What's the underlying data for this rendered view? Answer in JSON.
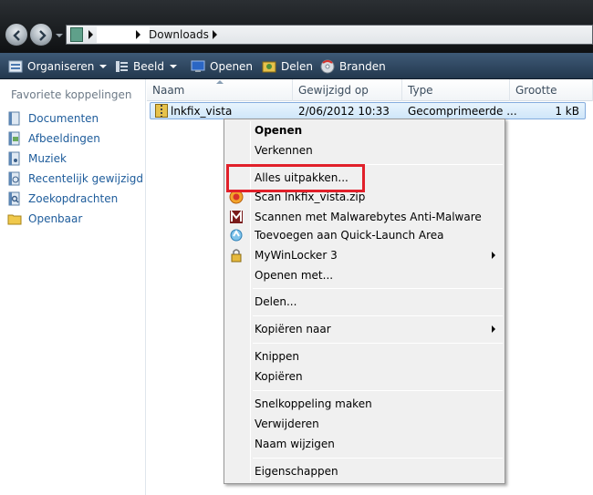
{
  "address": {
    "crumb": "Downloads"
  },
  "toolbar": {
    "organise": "Organiseren",
    "view": "Beeld",
    "open": "Openen",
    "share": "Delen",
    "burn": "Branden"
  },
  "nav": {
    "header": "Favoriete koppelingen",
    "items": [
      {
        "label": "Documenten",
        "icon": "documents-icon"
      },
      {
        "label": "Afbeeldingen",
        "icon": "pictures-icon"
      },
      {
        "label": "Muziek",
        "icon": "music-icon"
      },
      {
        "label": "Recentelijk gewijzigd",
        "icon": "recent-icon"
      },
      {
        "label": "Zoekopdrachten",
        "icon": "search-icon"
      },
      {
        "label": "Openbaar",
        "icon": "public-folder-icon"
      }
    ]
  },
  "columns": {
    "name": "Naam",
    "modified": "Gewijzigd op",
    "type": "Type",
    "size": "Grootte"
  },
  "file": {
    "name": "lnkfix_vista",
    "modified": "2/06/2012 10:33",
    "type": "Gecomprimeerde ...",
    "size": "1 kB"
  },
  "menu": {
    "open": "Openen",
    "explore": "Verkennen",
    "extract_all": "Alles uitpakken...",
    "scan": "Scan lnkfix_vista.zip",
    "malwarebytes": "Scannen met Malwarebytes Anti-Malware",
    "quicklaunch": "Toevoegen aan Quick-Launch Area",
    "mywinlocker": "MyWinLocker 3",
    "open_with": "Openen met...",
    "share": "Delen...",
    "copy_to": "Kopiëren naar",
    "cut": "Knippen",
    "copy": "Kopiëren",
    "shortcut": "Snelkoppeling maken",
    "delete": "Verwijderen",
    "rename": "Naam wijzigen",
    "properties": "Eigenschappen"
  },
  "colors": {
    "highlight": "#e1202a",
    "link": "#1e5c9b",
    "toolbar": "#2e4661"
  }
}
